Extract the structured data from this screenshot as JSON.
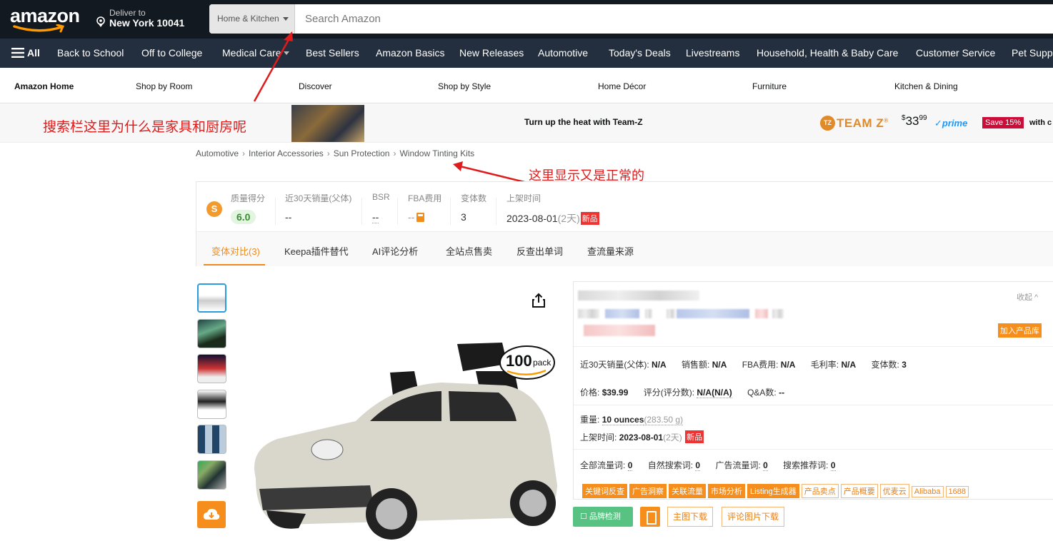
{
  "nav1": {
    "logo": "amazon",
    "deliver_line1": "Deliver to",
    "deliver_line2": "New York 10041",
    "search_category": "Home & Kitchen",
    "search_placeholder": "Search Amazon"
  },
  "nav2": {
    "all": "All",
    "items": [
      "Back to School",
      "Off to College",
      "Medical Care",
      "Best Sellers",
      "Amazon Basics",
      "New Releases",
      "Automotive",
      "Today's Deals",
      "Livestreams",
      "Household, Health & Baby Care",
      "Customer Service",
      "Pet Supp"
    ]
  },
  "nav3": {
    "items": [
      "Amazon Home",
      "Shop by Room",
      "Discover",
      "Shop by Style",
      "Home Décor",
      "Furniture",
      "Kitchen & Dining"
    ]
  },
  "banner": {
    "message": "Turn up the heat with Team-Z",
    "brand_icon": "TZ",
    "brand": "TEAM Z",
    "brand_mark": "®",
    "price_symbol": "$",
    "price_whole": "33",
    "price_fraction": "99",
    "prime": "✓prime",
    "save": "Save 15%",
    "with": "with c"
  },
  "annotations": {
    "top": "搜索栏这里为什么是家具和厨房呢",
    "crumbs": "这里显示又是正常的"
  },
  "breadcrumbs": [
    "Automotive",
    "Interior Accessories",
    "Sun Protection",
    "Window Tinting Kits"
  ],
  "stats": {
    "coin": "S",
    "quality_label": "质量得分",
    "quality_value": "6.0",
    "sales_label": "近30天销量(父体)",
    "sales_value": "--",
    "bsr_label": "BSR",
    "bsr_value": "--",
    "fba_label": "FBA费用",
    "fba_value": "--",
    "variants_label": "变体数",
    "variants_value": "3",
    "listed_label": "上架时间",
    "listed_date": "2023-08-01",
    "listed_days": "(2天)",
    "new_tag": "新品"
  },
  "tabs": [
    "变体对比(3)",
    "Keepa插件替代",
    "AI评论分析",
    "全站点售卖",
    "反查出单词",
    "查流量来源"
  ],
  "product": {
    "pack_count": "100",
    "pack_word": "pack"
  },
  "info": {
    "collapse": "收起",
    "add_library": "加入产品库",
    "sales_label": "近30天销量(父体):",
    "sales_value": "N/A",
    "revenue_label": "销售额:",
    "revenue_value": "N/A",
    "fba_label": "FBA费用:",
    "fba_value": "N/A",
    "margin_label": "毛利率:",
    "margin_value": "N/A",
    "variants_label": "变体数:",
    "variants_value": "3",
    "price_label": "价格:",
    "price_value": "$39.99",
    "rating_label": "评分(评分数):",
    "rating_value": "N/A(N/A)",
    "qa_label": "Q&A数:",
    "qa_value": "--",
    "weight_label": "重量:",
    "weight_value": "10 ounces",
    "weight_grams": "(283.50 g)",
    "listed_label": "上架时间:",
    "listed_value": "2023-08-01",
    "listed_days": "(2天)",
    "new_tag": "新品",
    "traffic_all_label": "全部流量词:",
    "traffic_all": "0",
    "organic_label": "自然搜索词:",
    "organic": "0",
    "ad_label": "广告流量词:",
    "ad": "0",
    "recommend_label": "搜索推荐词:",
    "recommend": "0",
    "tags": [
      "关键词反查",
      "广告洞察",
      "关联流量",
      "市场分析",
      "Listing生成器",
      "产品卖点",
      "产品概要",
      "优麦云",
      "Alibaba",
      "1688"
    ],
    "brand_check": "品牌检测",
    "main_img_dl": "主图下载",
    "review_img_dl": "评论图片下载"
  }
}
